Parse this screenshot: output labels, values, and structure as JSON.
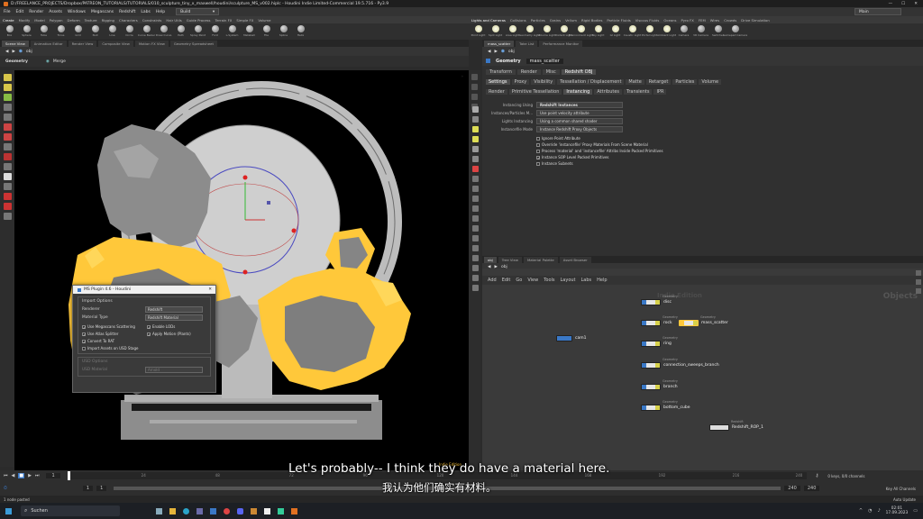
{
  "window": {
    "title": "D:/FREELANCE_PROJECTS/Dropbox/PATREON_TUTORIALS/TUTORIALS/010_sculpture_tiny_x_maxwell/houdini/sculpture_MS_v002.hiplc - Houdini Indie Limited-Commercial 19.5.716 - Py3.9"
  },
  "menu": {
    "items": [
      "File",
      "Edit",
      "Render",
      "Assets",
      "Windows",
      "Megascans",
      "Redshift",
      "Labs",
      "Help"
    ],
    "desktop": "Build",
    "main_desktop": "Main"
  },
  "shelf": {
    "tabs": [
      "Create",
      "Modify",
      "Model",
      "Polygon",
      "Deform",
      "Texture",
      "Rigging",
      "Characters",
      "Constraints",
      "Hair Utils",
      "Guide Process",
      "Terrain FX",
      "Simple FX",
      "Volume"
    ],
    "tools": [
      "Box",
      "Sphere",
      "Tube",
      "Torus",
      "Grid",
      "Null",
      "Line",
      "Circle",
      "Curve Bezier",
      "Draw Curve",
      "Path",
      "Spray Paint",
      "Font",
      "L-System",
      "Metaball",
      "File",
      "Spline",
      "Helix"
    ],
    "right_tabs": [
      "Lights and Cameras",
      "Collisions",
      "Particles",
      "Grains",
      "Vellum",
      "Rigid Bodies",
      "Particle Fluids",
      "Viscous Fluids",
      "Oceans",
      "Pyro FX",
      "FEM",
      "Wires",
      "Crowds",
      "Drive Simulation"
    ],
    "right_tools": [
      "Point Light",
      "Spot Light",
      "Area Light",
      "Geometry Light",
      "Volume Light",
      "Distant Light",
      "Environment Light",
      "Sky Light",
      "GI Light",
      "Caustic Light",
      "Portal Light",
      "Ambient Light",
      "Camera",
      "VR Camera",
      "Switcher",
      "Gamepad Camera"
    ]
  },
  "left_panel": {
    "tabs": [
      "Scene View",
      "Animation Editor",
      "Render View",
      "Composite View",
      "Motion FX View",
      "Geometry Spreadsheet"
    ],
    "path": "obj",
    "context": "Geometry",
    "view_mode": "Merge"
  },
  "plugin_dialog": {
    "title": "MS Plugin 4.6 - Houdini",
    "import_options": "Import Options",
    "renderer_label": "Renderer",
    "renderer_value": "Redshift",
    "material_type_label": "Material Type",
    "material_type_value": "Redshift Material",
    "checks": [
      {
        "label": "Use Megascans Scattering",
        "checked": true
      },
      {
        "label": "Enable LODs",
        "checked": true
      },
      {
        "label": "Use Atlas Splitter",
        "checked": true
      },
      {
        "label": "Apply Motion (Plants)",
        "checked": true
      },
      {
        "label": "Convert To RAT",
        "checked": true
      },
      {
        "label": "",
        "checked": false
      },
      {
        "label": "Import Assets on USD Stage",
        "checked": false
      }
    ],
    "usd_options": "USD Options",
    "usd_material_label": "USD Material",
    "usd_material_value": "Arnold"
  },
  "right_panel": {
    "tabs": [
      "mass_scatter",
      "Take List",
      "Performance Monitor"
    ],
    "node_type": "Geometry",
    "node_name": "mass_scatter",
    "top_tabs": [
      "Transform",
      "Render",
      "Misc",
      "Redshift OBJ"
    ],
    "sub_tabs": [
      "Settings",
      "Proxy",
      "Visibility",
      "Tessellation / Displacement",
      "Matte",
      "Retarget",
      "Particles",
      "Volume"
    ],
    "sub_tabs2": [
      "Render",
      "Primitive Tessellation",
      "Instancing",
      "Attributes",
      "Transients",
      "IPR"
    ],
    "params": [
      {
        "label": "Instancing Using",
        "value": "Redshift Instances"
      },
      {
        "label": "Instances/Particles M...",
        "value": "Use point velocity attribute"
      },
      {
        "label": "Lights Instancing",
        "value": "Using a common shared shader"
      },
      {
        "label": "Instancefile Mode",
        "value": "Instance Redshift Proxy Objects"
      }
    ],
    "checks": [
      {
        "label": "Ignore Point Attribute",
        "checked": false
      },
      {
        "label": "Override 'instancefile' Proxy Materials From Scene Material",
        "checked": false
      },
      {
        "label": "Process 'material' and 'instancefile' Attribs Inside Packed Primitives",
        "checked": false
      },
      {
        "label": "Instance SOP Level Packed Primitives",
        "checked": true
      },
      {
        "label": "Instance Subnets",
        "checked": false
      }
    ]
  },
  "network": {
    "tabs": [
      "obj",
      "Tree View",
      "Material Palette",
      "Asset Browser"
    ],
    "path": "obj",
    "menu": [
      "Add",
      "Edit",
      "Go",
      "View",
      "Tools",
      "Layout",
      "Labs",
      "Help"
    ],
    "watermark": "Indie Edition",
    "context_label": "Objects",
    "nodes": [
      {
        "name": "disc",
        "type": "Geometry"
      },
      {
        "name": "rock",
        "type": "Geometry"
      },
      {
        "name": "mass_scatter",
        "type": "Geometry"
      },
      {
        "name": "ring",
        "type": "Geometry"
      },
      {
        "name": "connection_sweeps_branch",
        "type": "Geometry"
      },
      {
        "name": "branch",
        "type": "Geometry"
      },
      {
        "name": "bottom_cube",
        "type": "Geometry"
      },
      {
        "name": "Redshift_ROP_1",
        "type": "Redshift"
      },
      {
        "name": "cam1",
        "type": ""
      }
    ]
  },
  "timeline": {
    "frame": "1",
    "ticks": [
      "1",
      "24",
      "48",
      "72",
      "96",
      "120",
      "144",
      "168",
      "192",
      "216",
      "240"
    ],
    "start": "1",
    "end": "240",
    "end2": "240",
    "keys_label": "0 keys, 0/0 channels",
    "channels_label": "Key All Channels",
    "auto_update": "Auto Update",
    "status": "1 node pasted"
  },
  "subtitles": {
    "en": "Let's probably-- I think they do have a material here.",
    "zh": "我认为他们确实有材料。"
  },
  "taskbar": {
    "search": "Suchen",
    "time": "02:01",
    "date": "17.09.2023"
  },
  "colors": {
    "selection_yellow": "#ffc83a",
    "accent_blue": "#3a78c6"
  }
}
